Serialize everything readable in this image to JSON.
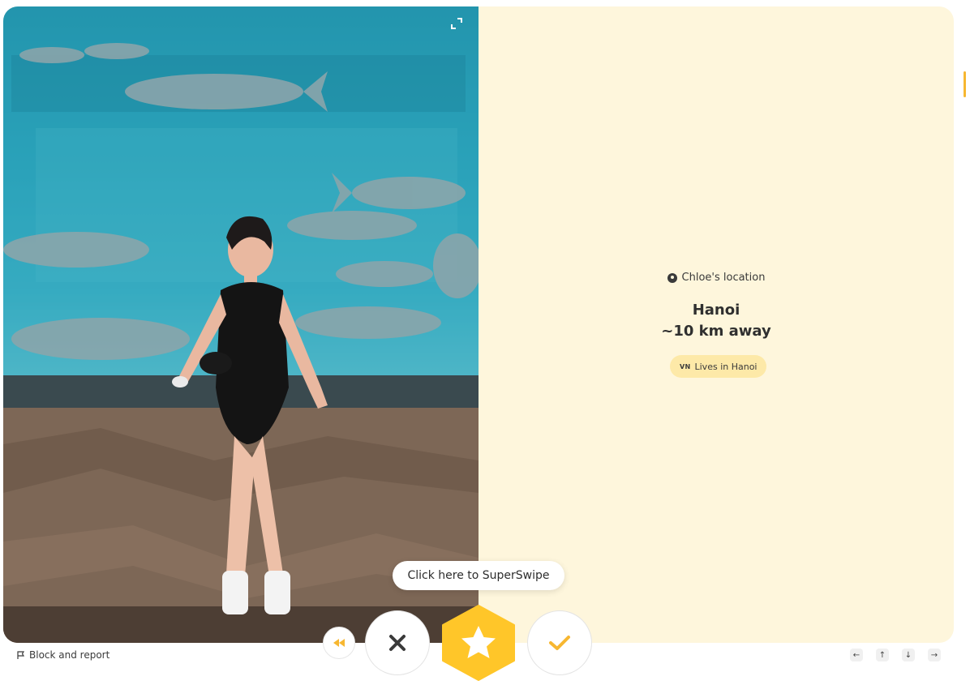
{
  "profile": {
    "location_heading": "Chloe's location",
    "city": "Hanoi",
    "distance": "~10 km away",
    "lives_country_code": "VN",
    "lives_label": "Lives in Hanoi"
  },
  "superswipe_tooltip": "Click here to SuperSwipe",
  "footer": {
    "report_label": "Block and report",
    "keys": [
      "←",
      "↑",
      "↓",
      "→"
    ]
  },
  "icons": {
    "expand": "expand-icon",
    "pin": "location-pin-icon",
    "rewind": "rewind-icon",
    "pass": "close-icon",
    "superswipe": "star-icon",
    "like": "check-icon",
    "flag": "flag-icon"
  },
  "colors": {
    "card_background": "#fef6dc",
    "accent": "#f7b731",
    "superswipe": "#ffc629",
    "pill": "#fde9a8"
  }
}
